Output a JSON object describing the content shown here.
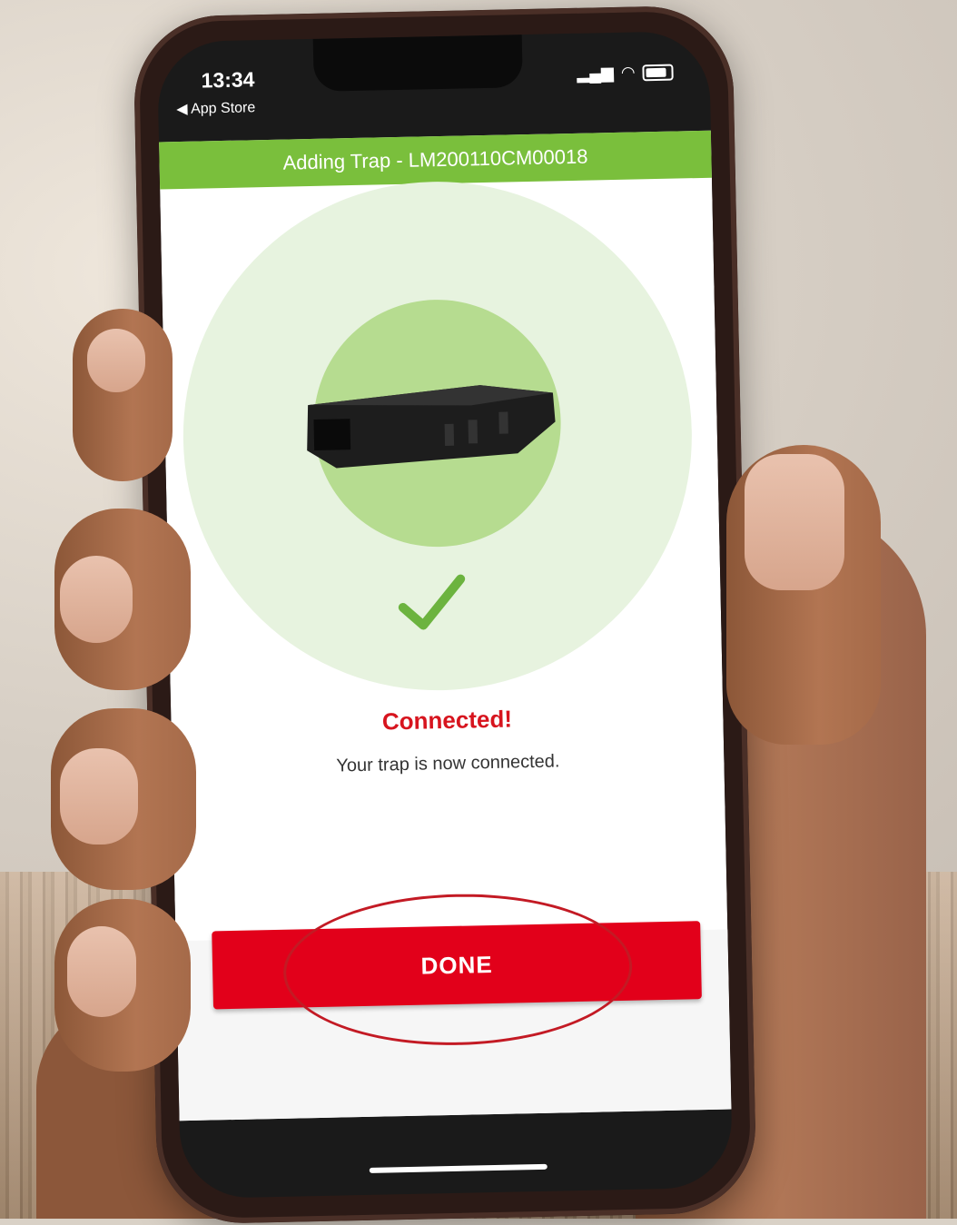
{
  "status_bar": {
    "time": "13:34",
    "back_label": "◀ App Store"
  },
  "header": {
    "title": "Adding Trap - LM200110CM00018",
    "color": "#7abf3c"
  },
  "result": {
    "title": "Connected!",
    "message": "Your trap is now connected.",
    "title_color": "#d7141e"
  },
  "actions": {
    "done_label": "DONE",
    "button_color": "#e2001a"
  },
  "icons": {
    "status": "check-icon",
    "device": "trap-device-icon"
  }
}
